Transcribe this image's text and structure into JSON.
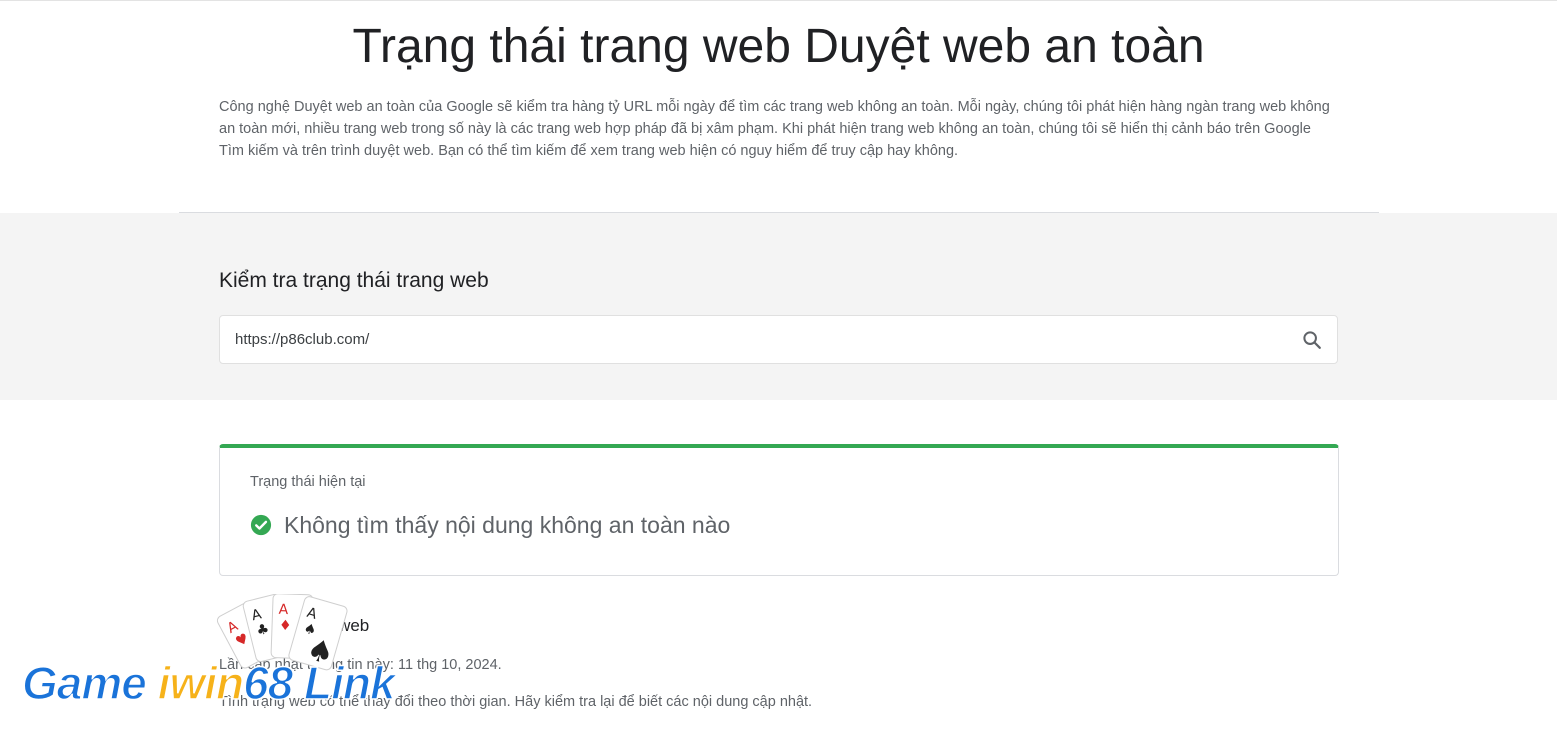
{
  "header": {
    "title": "Trạng thái trang web Duyệt web an toàn",
    "intro": "Công nghệ Duyệt web an toàn của Google sẽ kiểm tra hàng tỷ URL mỗi ngày để tìm các trang web không an toàn. Mỗi ngày, chúng tôi phát hiện hàng ngàn trang web không an toàn mới, nhiều trang web trong số này là các trang web hợp pháp đã bị xâm phạm. Khi phát hiện trang web không an toàn, chúng tôi sẽ hiển thị cảnh báo trên Google Tìm kiếm và trên trình duyệt web. Bạn có thể tìm kiếm để xem trang web hiện có nguy hiểm để truy cập hay không."
  },
  "check": {
    "heading": "Kiểm tra trạng thái trang web",
    "search_value": "https://p86club.com/",
    "search_icon": "search-icon"
  },
  "status": {
    "label": "Trạng thái hiện tại",
    "result": "Không tìm thấy nội dung không an toàn nào",
    "icon": "check-circle-icon",
    "accent_color": "#34a853"
  },
  "info": {
    "heading": "Thông tin trang web",
    "updated": "Lần cập nhật thông tin này: 11 thg 10, 2024.",
    "note": "Tình trạng web có thể thay đổi theo thời gian. Hãy kiểm tra lại để biết các nội dung cập nhật."
  },
  "watermark": {
    "text_game": "Game ",
    "text_iwin": "iwin",
    "text_rest": "68 Link"
  }
}
